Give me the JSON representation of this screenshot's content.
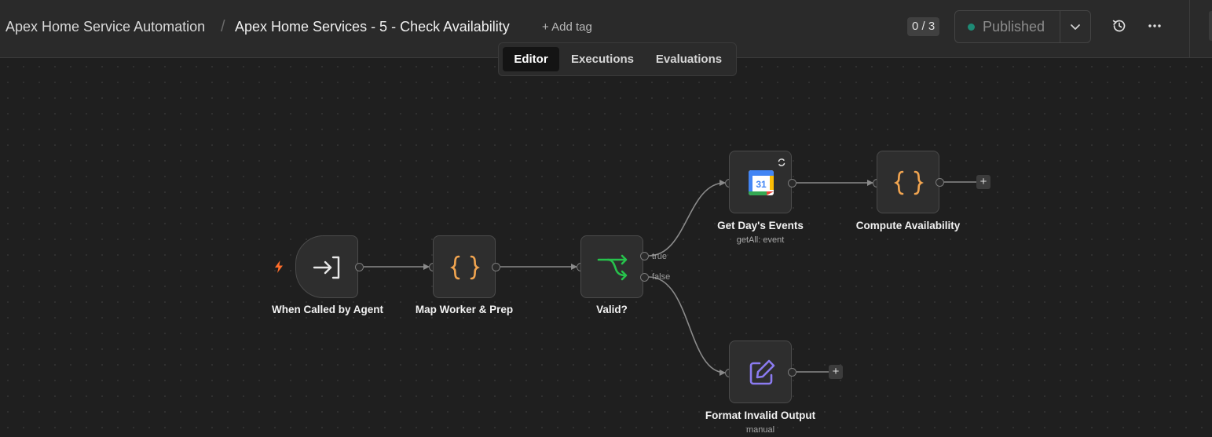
{
  "header": {
    "project": "Apex Home Service Automation",
    "separator": "/",
    "workflow_name": "Apex Home Services - 5 - Check Availability",
    "add_tag": "+ Add tag",
    "counter": "0 / 3",
    "publish_label": "Published",
    "publish_status_color": "#1e8a75"
  },
  "tabs": [
    {
      "label": "Editor",
      "active": true
    },
    {
      "label": "Executions",
      "active": false
    },
    {
      "label": "Evaluations",
      "active": false
    }
  ],
  "nodes": {
    "trigger": {
      "label": "When Called by Agent",
      "icon": "execute-workflow-trigger-icon"
    },
    "map": {
      "label": "Map Worker & Prep",
      "icon": "code-braces-icon"
    },
    "valid": {
      "label": "Valid?",
      "icon": "if-branch-icon",
      "true_label": "true",
      "false_label": "false"
    },
    "events": {
      "label": "Get Day's Events",
      "sublabel": "getAll: event",
      "icon": "google-calendar-icon",
      "calendar_day": "31"
    },
    "compute": {
      "label": "Compute Availability",
      "icon": "code-braces-icon"
    },
    "format": {
      "label": "Format Invalid Output",
      "sublabel": "manual",
      "icon": "edit-pencil-icon"
    }
  },
  "colors": {
    "code_icon": "#f2a550",
    "if_icon": "#27c24c",
    "edit_icon": "#8b7bf0",
    "trigger_bolt": "#ff6d2a"
  },
  "plus_symbol": "+"
}
